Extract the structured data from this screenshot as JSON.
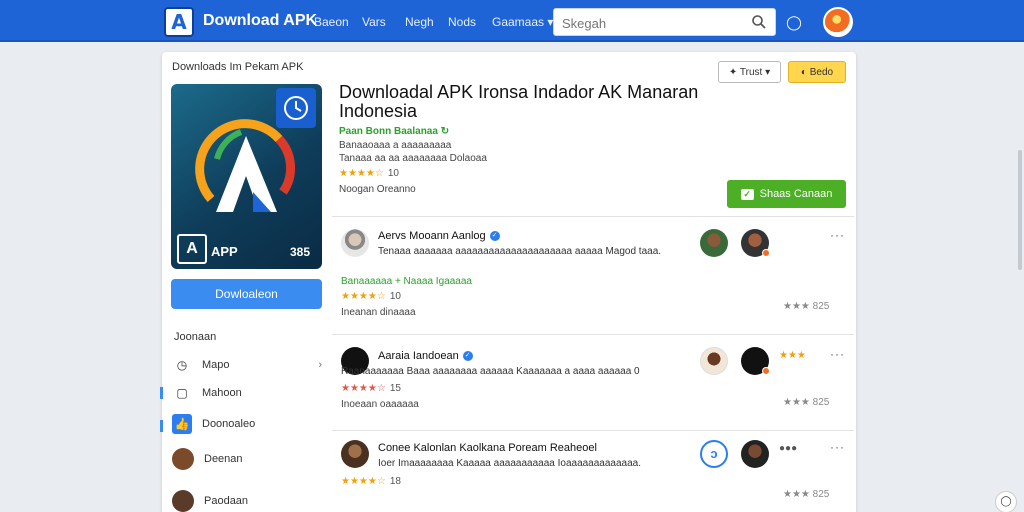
{
  "header": {
    "logo_letter": "A",
    "brand": "Download APK",
    "nav": [
      "Baeon",
      "Vars",
      "Negh",
      "Nods",
      "Gaamaas"
    ],
    "search_placeholder": "Skegah"
  },
  "breadcrumb": "Downloads Im Pekam APK",
  "app": {
    "icon_name": "APP",
    "icon_number": "385",
    "download_label": "Dowloaleon",
    "title": "Downloadal APK Ironsa Indador AK Manaran Indonesia",
    "developer": "Paan Bonn Baalanaa",
    "meta1": "Banaaoaaa a aaaaaaaaa",
    "meta2": "Tanaaa aa aa aaaaaaaa Dolaoaa",
    "rating": "★★★★☆",
    "rating_count": "10",
    "date": "Noogan Oreanno",
    "trust_label": "Trust",
    "gold_label": "Bedo",
    "green_label": "Shaas Canaan"
  },
  "sidebar": {
    "heading": "Joonaan",
    "items": [
      {
        "label": "Mapo",
        "icon": "clock-icon"
      },
      {
        "label": "Mahoon",
        "icon": "box-icon"
      },
      {
        "label": "Doonoaleo",
        "icon": "thumbs-up-icon"
      },
      {
        "label": "Deenan",
        "icon": "avatar-icon"
      },
      {
        "label": "Paodaan",
        "icon": "avatar-icon"
      }
    ]
  },
  "reviews": [
    {
      "name": "Aervs Mooann Aanlog",
      "text": "Tenaaa aaaaaaa aaaaaaaaaaaaaaaaaaaaa aaaaa Magod taaa.",
      "tag": "Banaaaaaa + Naaaa Igaaaaa",
      "rating": "★★★★☆",
      "count": "10",
      "date": "Ineanan dinaaaa",
      "right_stars": "★★★ 825"
    },
    {
      "name": "Aaraia Iandoean",
      "text": "Raanaaaaaaa Baaa aaaaaaaa aaaaaa Kaaaaaaa a aaaa aaaaaa 0",
      "rating": "★★★★☆",
      "count": "15",
      "date": "Inoeaan oaaaaaa",
      "right_stars": "★★★ 825",
      "badge": "★★★"
    },
    {
      "name": "Conee Kalonlan Kaolkana Poream Reaheoel",
      "text": "Ioer Imaaaaaaaa Kaaaaa aaaaaaaaaaa Ioaaaaaaaaaaaaa.",
      "rating": "★★★★☆",
      "count": "18",
      "right_stars": "★★★ 825"
    }
  ],
  "colors": {
    "topbar": "#1f64d6",
    "accent": "#3a8cf0",
    "green": "#4caf26",
    "gold": "#ffd64d"
  }
}
